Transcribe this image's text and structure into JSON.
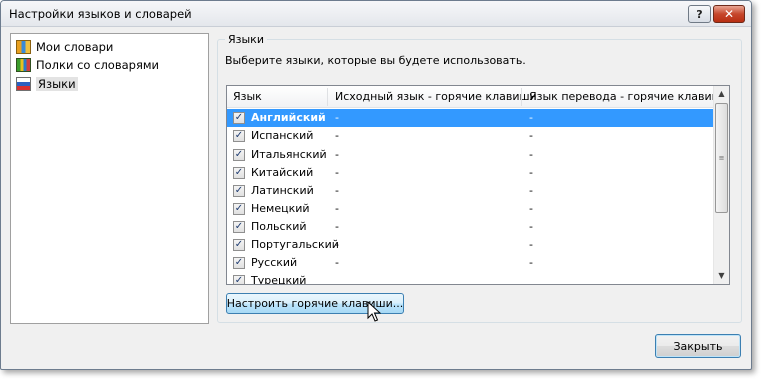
{
  "window": {
    "title": "Настройки языков и словарей",
    "help_label": "?",
    "close_label": "✕"
  },
  "sidebar": {
    "items": [
      {
        "label": "Мои словари",
        "icon": "dictionary-icon"
      },
      {
        "label": "Полки со словарями",
        "icon": "bookshelf-icon"
      },
      {
        "label": "Языки",
        "icon": "language-flag-icon",
        "selected": true
      }
    ]
  },
  "languages_group": {
    "legend": "Языки",
    "description": "Выберите языки, которые вы будете использовать.",
    "columns": [
      "Язык",
      "Исходный язык - горячие клавиши",
      "Язык перевода - горячие клавиши"
    ],
    "rows": [
      {
        "checked": true,
        "name": "Английский",
        "source_hotkey": "-",
        "target_hotkey": "-",
        "selected": true
      },
      {
        "checked": true,
        "name": "Испанский",
        "source_hotkey": "-",
        "target_hotkey": "-"
      },
      {
        "checked": true,
        "name": "Итальянский",
        "source_hotkey": "-",
        "target_hotkey": "-"
      },
      {
        "checked": true,
        "name": "Китайский",
        "source_hotkey": "-",
        "target_hotkey": "-"
      },
      {
        "checked": true,
        "name": "Латинский",
        "source_hotkey": "-",
        "target_hotkey": "-"
      },
      {
        "checked": true,
        "name": "Немецкий",
        "source_hotkey": "-",
        "target_hotkey": "-"
      },
      {
        "checked": true,
        "name": "Польский",
        "source_hotkey": "-",
        "target_hotkey": "-"
      },
      {
        "checked": true,
        "name": "Португальский",
        "source_hotkey": "-",
        "target_hotkey": "-"
      },
      {
        "checked": true,
        "name": "Русский",
        "source_hotkey": "-",
        "target_hotkey": "-"
      },
      {
        "checked": true,
        "name": "Турецкий",
        "source_hotkey": "",
        "target_hotkey": ""
      }
    ],
    "hotkeys_button": "Настроить горячие клавиши..."
  },
  "footer": {
    "close_button": "Закрыть"
  },
  "colors": {
    "selection": "#3399ff",
    "window_bg": "#f0f0f0",
    "focus_border": "#3c7fb1"
  }
}
